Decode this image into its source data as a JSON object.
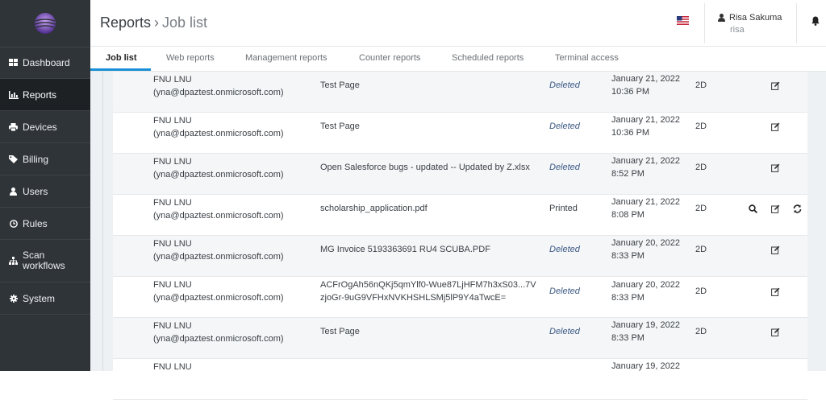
{
  "header": {
    "breadcrumb_root": "Reports",
    "breadcrumb_sep": "›",
    "breadcrumb_current": "Job list",
    "user_name": "Risa Sakuma",
    "user_login": "risa",
    "flag_icon": "us-flag-icon",
    "bell_icon": "bell-icon"
  },
  "sidebar": {
    "items": [
      {
        "label": "Dashboard",
        "icon": "dashboard-icon"
      },
      {
        "label": "Reports",
        "icon": "bar-chart-icon"
      },
      {
        "label": "Devices",
        "icon": "printer-icon"
      },
      {
        "label": "Billing",
        "icon": "tag-icon"
      },
      {
        "label": "Users",
        "icon": "user-icon"
      },
      {
        "label": "Rules",
        "icon": "clock-icon"
      },
      {
        "label": "Scan",
        "label2": "workflows",
        "icon": "sitemap-icon"
      },
      {
        "label": "System",
        "icon": "gear-icon"
      }
    ]
  },
  "tabs": [
    "Job list",
    "Web reports",
    "Management reports",
    "Counter reports",
    "Scheduled reports",
    "Terminal access"
  ],
  "rows": [
    {
      "user": "FNU LNU",
      "email": "(yna@dpaztest.onmicrosoft.com)",
      "doc": "Test Page",
      "doc2": "",
      "status": "Deleted",
      "date": "January 21, 2022",
      "time": "10:36 PM",
      "dur": "2D"
    },
    {
      "user": "FNU LNU",
      "email": "(yna@dpaztest.onmicrosoft.com)",
      "doc": "Test Page",
      "doc2": "",
      "status": "Deleted",
      "date": "January 21, 2022",
      "time": "10:36 PM",
      "dur": "2D"
    },
    {
      "user": "FNU LNU",
      "email": "(yna@dpaztest.onmicrosoft.com)",
      "doc": "Open Salesforce bugs - updated -- Updated by Z.xlsx",
      "doc2": "",
      "status": "Deleted",
      "date": "January 21, 2022",
      "time": "8:52 PM",
      "dur": "2D"
    },
    {
      "user": "FNU LNU",
      "email": "(yna@dpaztest.onmicrosoft.com)",
      "doc": "scholarship_application.pdf",
      "doc2": "",
      "status": "Printed",
      "date": "January 21, 2022",
      "time": "8:08 PM",
      "dur": "2D"
    },
    {
      "user": "FNU LNU",
      "email": "(yna@dpaztest.onmicrosoft.com)",
      "doc": "MG Invoice 5193363691 RU4 SCUBA.PDF",
      "doc2": "",
      "status": "Deleted",
      "date": "January 20, 2022",
      "time": "8:33 PM",
      "dur": "2D"
    },
    {
      "user": "FNU LNU",
      "email": "(yna@dpaztest.onmicrosoft.com)",
      "doc": "ACFrOgAh56nQKj5qmYlf0-Wue87LjHFM7h3xS03...7V",
      "doc2": "zjoGr-9uG9VFHxNVKHSHLSMj5lP9Y4aTwcE=",
      "status": "Deleted",
      "date": "January 20, 2022",
      "time": "8:33 PM",
      "dur": "2D"
    },
    {
      "user": "FNU LNU",
      "email": "(yna@dpaztest.onmicrosoft.com)",
      "doc": "Test Page",
      "doc2": "",
      "status": "Deleted",
      "date": "January 19, 2022",
      "time": "8:33 PM",
      "dur": "2D"
    },
    {
      "user": "FNU LNU",
      "email": "",
      "doc": "",
      "doc2": "",
      "status": "",
      "date": "January 19, 2022",
      "time": "",
      "dur": ""
    }
  ],
  "colors": {
    "sidebar_bg": "#2f3438",
    "accent": "#1a8fd6",
    "deleted_status": "#3d5a86"
  }
}
